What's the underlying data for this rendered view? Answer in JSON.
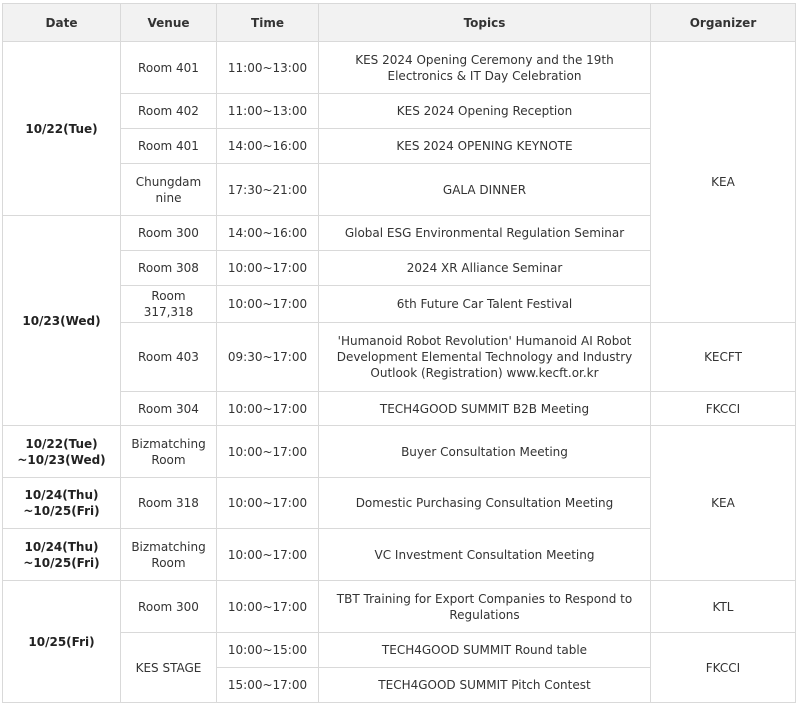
{
  "headers": {
    "date": "Date",
    "venue": "Venue",
    "time": "Time",
    "topics": "Topics",
    "organizer": "Organizer"
  },
  "dates": {
    "d1": "10/22(Tue)",
    "d2": "10/23(Wed)",
    "d3a": "10/22(Tue)",
    "d3b": "~10/23(Wed)",
    "d4a": "10/24(Thu)",
    "d4b": "~10/25(Fri)",
    "d5a": "10/24(Thu)",
    "d5b": "~10/25(Fri)",
    "d6": "10/25(Fri)"
  },
  "rows": [
    {
      "venue": "Room 401",
      "time": "11:00~13:00",
      "topic": "KES 2024 Opening Ceremony and the 19th Electronics & IT Day Celebration"
    },
    {
      "venue": "Room 402",
      "time": "11:00~13:00",
      "topic": "KES 2024 Opening Reception"
    },
    {
      "venue": "Room 401",
      "time": "14:00~16:00",
      "topic": "KES 2024 OPENING KEYNOTE"
    },
    {
      "venue": "Chungdam nine",
      "time": "17:30~21:00",
      "topic": "GALA DINNER"
    },
    {
      "venue": "Room 300",
      "time": "14:00~16:00",
      "topic": "Global ESG Environmental Regulation Seminar"
    },
    {
      "venue": "Room 308",
      "time": "10:00~17:00",
      "topic": "2024 XR Alliance Seminar"
    },
    {
      "venue": "Room 317,318",
      "time": "10:00~17:00",
      "topic": "6th Future Car Talent Festival"
    },
    {
      "venue": "Room 403",
      "time": "09:30~17:00",
      "topic": "'Humanoid Robot Revolution' Humanoid AI Robot Development Elemental Technology and Industry Outlook (Registration) www.kecft.or.kr"
    },
    {
      "venue": "Room 304",
      "time": "10:00~17:00",
      "topic": "TECH4GOOD SUMMIT B2B Meeting"
    },
    {
      "venue": "Bizmatching Room",
      "time": "10:00~17:00",
      "topic": "Buyer Consultation Meeting"
    },
    {
      "venue": "Room 318",
      "time": "10:00~17:00",
      "topic": "Domestic Purchasing Consultation Meeting"
    },
    {
      "venue": "Bizmatching Room",
      "time": "10:00~17:00",
      "topic": "VC Investment Consultation Meeting"
    },
    {
      "venue": "Room 300",
      "time": "10:00~17:00",
      "topic": "TBT Training for Export Companies to Respond to Regulations"
    },
    {
      "venue": "KES STAGE",
      "time": "10:00~15:00",
      "topic": "TECH4GOOD SUMMIT Round table"
    },
    {
      "venue": "",
      "time": "15:00~17:00",
      "topic": "TECH4GOOD SUMMIT Pitch Contest"
    }
  ],
  "organizers": {
    "kea1": "KEA",
    "kecft": "KECFT",
    "fkcci1": "FKCCI",
    "kea2": "KEA",
    "ktl": "KTL",
    "fkcci2": "FKCCI"
  }
}
